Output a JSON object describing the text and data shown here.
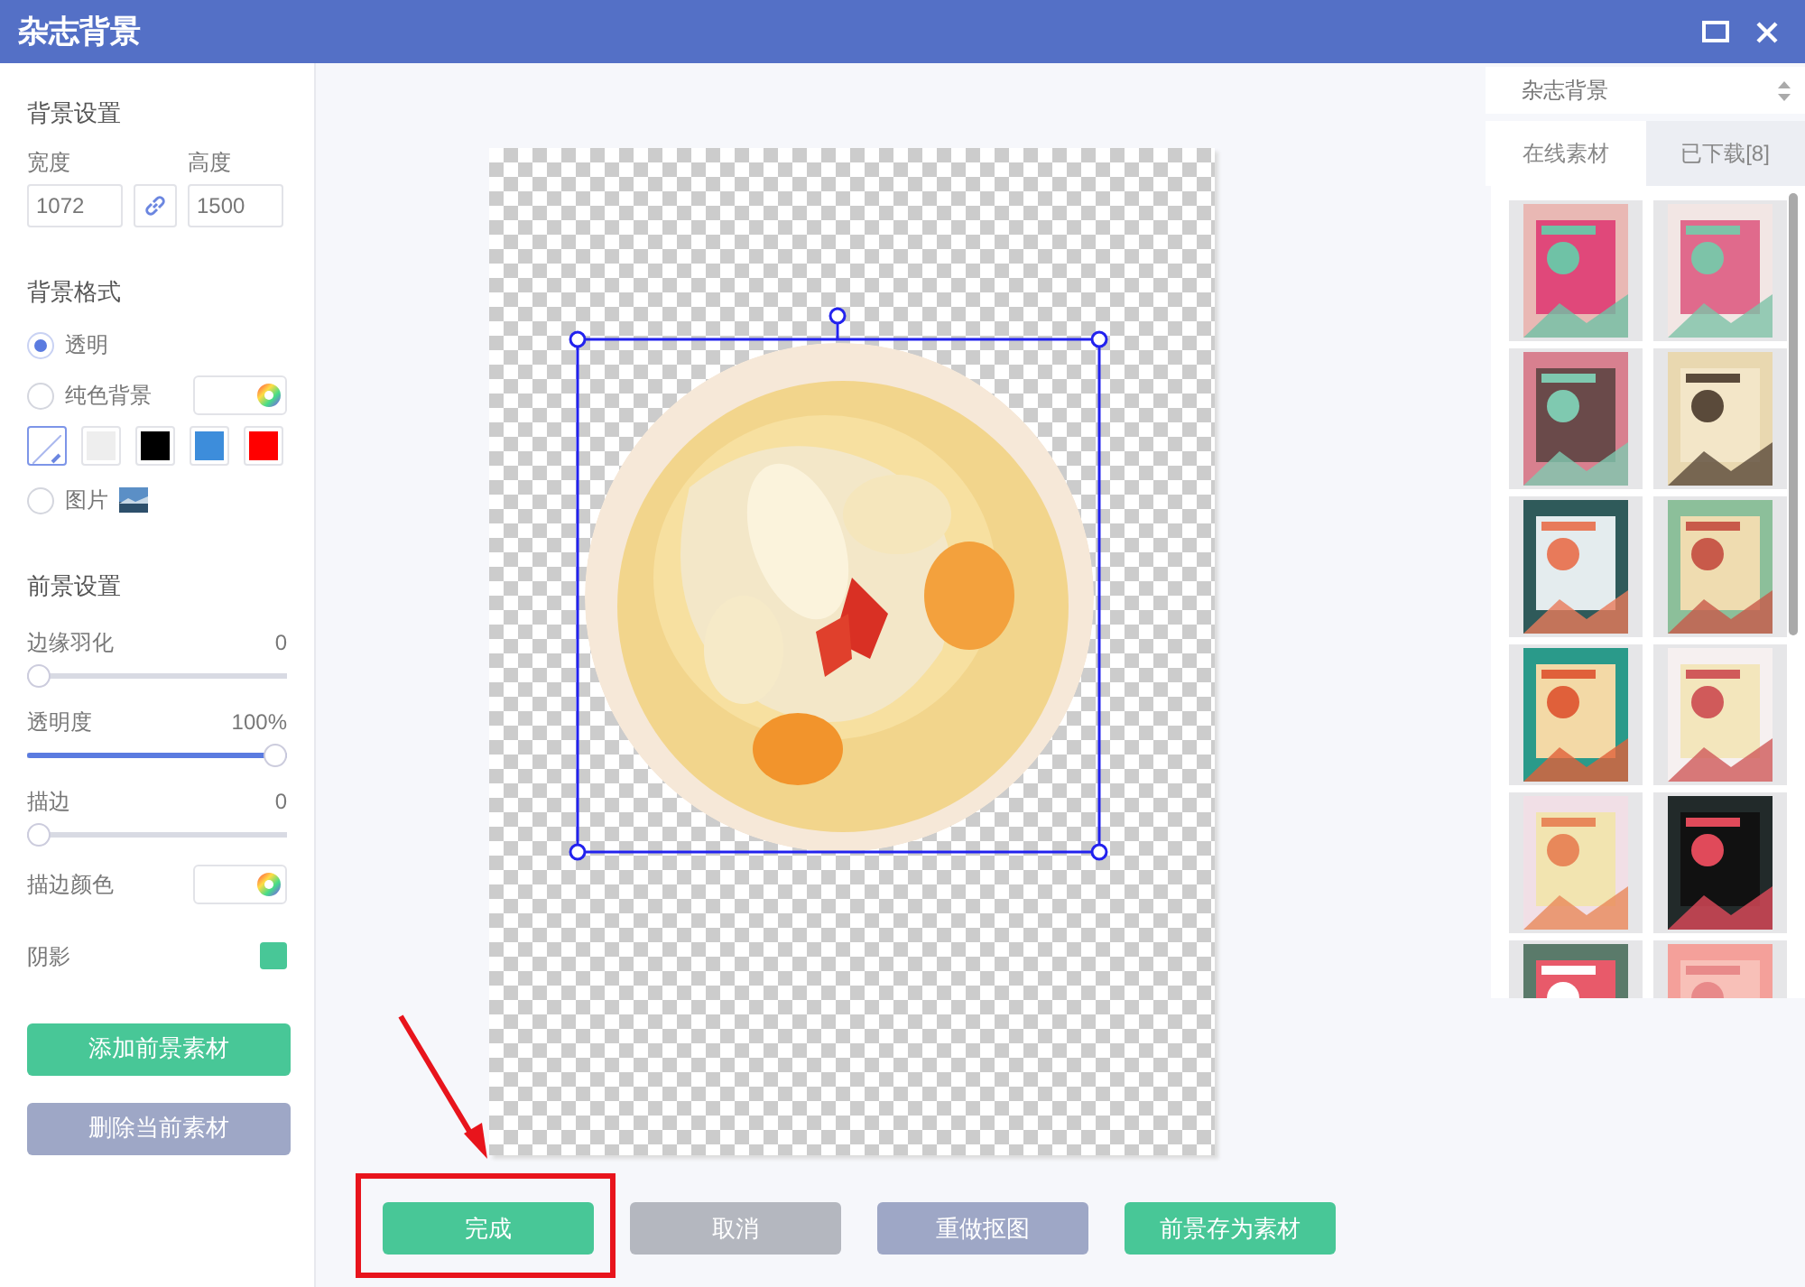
{
  "window": {
    "title": "杂志背景"
  },
  "background_settings": {
    "heading": "背景设置",
    "width": {
      "label": "宽度",
      "value": "1072"
    },
    "height": {
      "label": "高度",
      "value": "1500"
    },
    "linked": true
  },
  "background_format": {
    "heading": "背景格式",
    "options": [
      {
        "label": "透明",
        "kind": "plain",
        "selected": true
      },
      {
        "label": "纯色背景",
        "kind": "color",
        "selected": false
      },
      {
        "label": "图片",
        "selected": false
      }
    ],
    "swatches": [
      {
        "kind": "none",
        "selected": true
      },
      {
        "kind": "color",
        "color": "#eeeeee",
        "selected": false
      },
      {
        "kind": "color",
        "color": "#000000",
        "selected": false
      },
      {
        "kind": "color",
        "color": "#3d8ddb",
        "selected": false
      },
      {
        "kind": "color",
        "color": "#ff0000",
        "selected": false
      }
    ]
  },
  "foreground_settings": {
    "heading": "前景设置",
    "sliders": [
      {
        "label": "边缘羽化",
        "reading": "0",
        "level": 0
      },
      {
        "label": "透明度",
        "reading": "100%",
        "level": 1
      },
      {
        "label": "描边",
        "reading": "0",
        "level": 0
      }
    ],
    "stroke_color": {
      "label": "描边颜色"
    },
    "shadow": {
      "label": "阴影",
      "on": true
    }
  },
  "side_buttons": [
    {
      "label": "添加前景素材",
      "kind": "primary"
    },
    {
      "label": "删除当前素材",
      "kind": "secondary"
    }
  ],
  "canvas": {
    "selected": true
  },
  "bottom_buttons": [
    {
      "label": "完成",
      "kind": "primary"
    },
    {
      "label": "取消",
      "kind": "muted"
    },
    {
      "label": "重做抠图",
      "kind": "secondary"
    },
    {
      "label": "前景存为素材",
      "kind": "primary"
    }
  ],
  "annotation": {
    "highlight": true,
    "arrow": true
  },
  "library": {
    "category": "杂志背景",
    "tabs": [
      {
        "label": "在线素材",
        "selected": true
      },
      {
        "label": "已下载[8]",
        "selected": false
      }
    ]
  }
}
